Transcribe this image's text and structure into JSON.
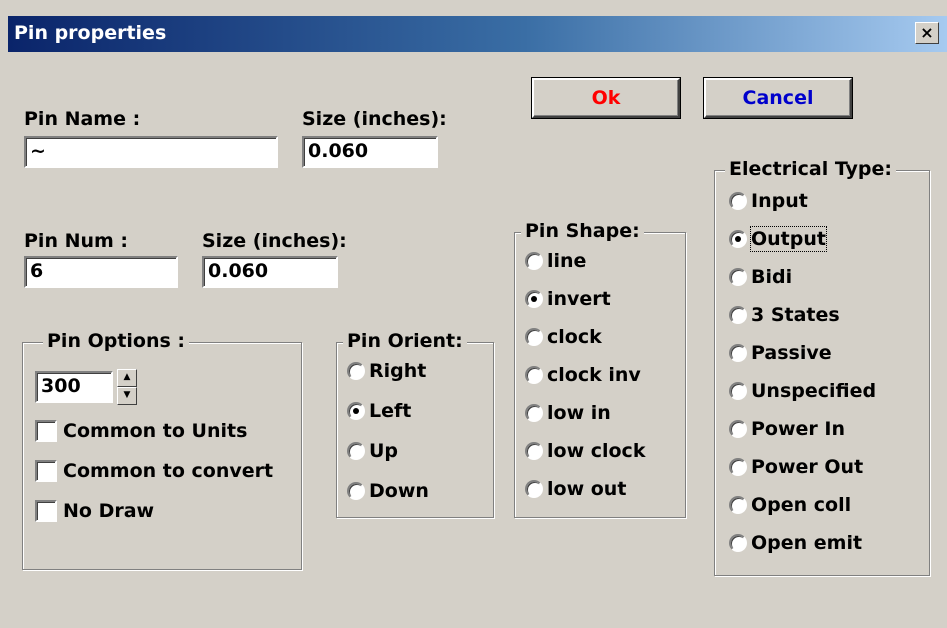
{
  "window": {
    "title": "Pin properties",
    "close_glyph": "×"
  },
  "buttons": {
    "ok_label": "Ok",
    "cancel_label": "Cancel",
    "ok_color": "#ff0000",
    "cancel_color": "#0000cc"
  },
  "pin_name": {
    "label": "Pin Name :",
    "value": "~"
  },
  "pin_name_size": {
    "label": "Size (inches):",
    "value": "0.060"
  },
  "pin_num": {
    "label": "Pin Num :",
    "value": "6"
  },
  "pin_num_size": {
    "label": "Size (inches):",
    "value": "0.060"
  },
  "pin_options": {
    "title": "Pin Options :",
    "length_value": "300",
    "checkboxes": [
      "Common to Units",
      "Common to convert",
      "No Draw"
    ]
  },
  "pin_orient": {
    "title": "Pin Orient:",
    "options": [
      "Right",
      "Left",
      "Up",
      "Down"
    ],
    "selected": "Left"
  },
  "pin_shape": {
    "title": "Pin Shape:",
    "options": [
      "line",
      "invert",
      "clock",
      "clock inv",
      "low in",
      "low clock",
      "low out"
    ],
    "selected": "invert"
  },
  "electrical_type": {
    "title": "Electrical Type:",
    "options": [
      "Input",
      "Output",
      "Bidi",
      "3 States",
      "Passive",
      "Unspecified",
      "Power In",
      "Power Out",
      "Open coll",
      "Open emit"
    ],
    "selected": "Output"
  }
}
